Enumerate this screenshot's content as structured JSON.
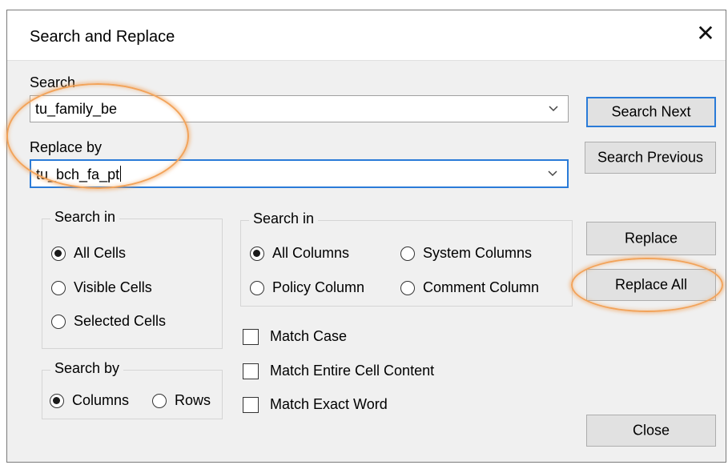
{
  "dialog": {
    "title": "Search and Replace",
    "close_icon": "close-icon"
  },
  "search": {
    "label": "Search",
    "value": "tu_family_be"
  },
  "replace": {
    "label": "Replace by",
    "value": "tu_bch_fa_pt"
  },
  "buttons": {
    "search_next": "Search Next",
    "search_previous": "Search Previous",
    "replace": "Replace",
    "replace_all": "Replace All",
    "close": "Close"
  },
  "search_in_cells": {
    "legend": "Search in",
    "options": [
      "All Cells",
      "Visible Cells",
      "Selected Cells"
    ],
    "selected": "All Cells"
  },
  "search_in_columns": {
    "legend": "Search in",
    "options": [
      "All Columns",
      "System Columns",
      "Policy Column",
      "Comment Column"
    ],
    "selected": "All Columns"
  },
  "search_by": {
    "legend": "Search by",
    "options": [
      "Columns",
      "Rows"
    ],
    "selected": "Columns"
  },
  "checkboxes": {
    "match_case": "Match Case",
    "match_entire": "Match Entire Cell Content",
    "match_exact": "Match Exact Word"
  },
  "colors": {
    "focus_blue": "#2a7bd8",
    "highlight_orange": "#f2a35a",
    "dialog_bg": "#f0f0f0"
  }
}
